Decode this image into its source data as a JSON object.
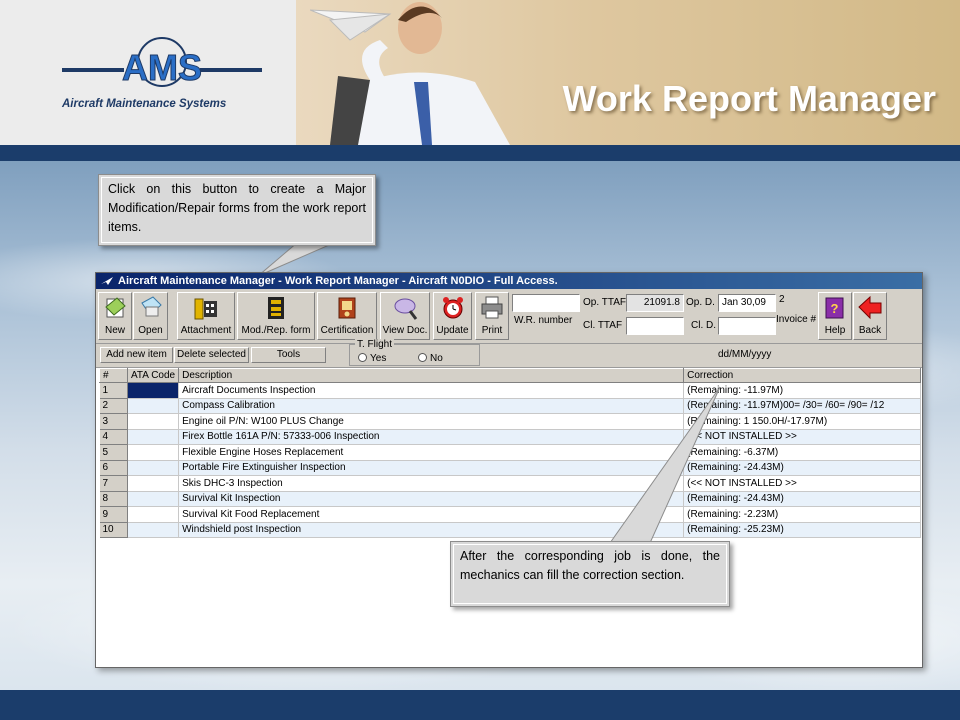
{
  "header": {
    "logo_letters": "AMS",
    "logo_tagline": "Aircraft Maintenance Systems",
    "slide_title": "Work Report Manager"
  },
  "callouts": {
    "top": "Click on this button to create a Major Modification/Repair forms from the work report items.",
    "bottom": "After the corresponding job is done, the mechanics can fill the correction section."
  },
  "window": {
    "title": "Aircraft Maintenance Manager - Work Report Manager - Aircraft N0DIO - Full Access."
  },
  "toolbar": {
    "buttons": [
      {
        "label": "New",
        "icon": "new-document-icon"
      },
      {
        "label": "Open",
        "icon": "open-document-icon"
      },
      {
        "label": "Attachment",
        "icon": "film-attachment-icon"
      },
      {
        "label": "Mod./Rep. form",
        "icon": "binder-form-icon"
      },
      {
        "label": "Certification",
        "icon": "certificate-icon"
      },
      {
        "label": "View Doc.",
        "icon": "magnifier-icon"
      },
      {
        "label": "Update",
        "icon": "alarm-clock-icon"
      },
      {
        "label": "Print",
        "icon": "printer-icon"
      },
      {
        "label": "Help",
        "icon": "help-book-icon"
      },
      {
        "label": "Back",
        "icon": "back-arrow-icon"
      }
    ],
    "wr_number_label": "W.R. number",
    "wr_number_value": "",
    "op_ttaf_label": "Op. TTAF",
    "op_ttaf_value": "21091.8",
    "cl_ttaf_label": "Cl. TTAF",
    "cl_ttaf_value": "",
    "op_d_label": "Op. D.",
    "op_d_value": "Jan 30,09",
    "cl_d_label": "Cl. D.",
    "cl_d_value": "",
    "invoice_value": "2",
    "invoice_label": "Invoice #"
  },
  "actions": {
    "add_label": "Add new item",
    "delete_label": "Delete selected",
    "tools_label": "Tools",
    "flight_group_label": "T. Flight",
    "yes_label": "Yes",
    "no_label": "No",
    "date_format": "dd/MM/yyyy"
  },
  "grid": {
    "columns": [
      "#",
      "ATA Code",
      "Description",
      "Correction"
    ],
    "rows": [
      {
        "num": "1",
        "ata": "",
        "desc": "Aircraft Documents  Inspection",
        "corr": "(Remaining: -11.97M)"
      },
      {
        "num": "2",
        "ata": "",
        "desc": "Compass  Calibration",
        "corr": "(Remaining: -11.97M)00=   /30=   /60=    /90=    /12"
      },
      {
        "num": "3",
        "ata": "",
        "desc": "Engine oil  P/N: W100 PLUS Change",
        "corr": "(Remaining: 1 150.0H/-17.97M)"
      },
      {
        "num": "4",
        "ata": "",
        "desc": "Firex Bottle 161A P/N: 57333-006 Inspection",
        "corr": "(<< NOT INSTALLED >>"
      },
      {
        "num": "5",
        "ata": "",
        "desc": "Flexible Engine Hoses  Replacement",
        "corr": "(Remaining: -6.37M)"
      },
      {
        "num": "6",
        "ata": "",
        "desc": "Portable Fire Extinguisher  Inspection",
        "corr": "(Remaining: -24.43M)"
      },
      {
        "num": "7",
        "ata": "",
        "desc": "Skis DHC-3 Inspection",
        "corr": "(<< NOT INSTALLED >>"
      },
      {
        "num": "8",
        "ata": "",
        "desc": "Survival Kit  Inspection",
        "corr": "(Remaining: -24.43M)"
      },
      {
        "num": "9",
        "ata": "",
        "desc": "Survival Kit Food  Replacement",
        "corr": "(Remaining: -2.23M)"
      },
      {
        "num": "10",
        "ata": "",
        "desc": "Windshield post  Inspection",
        "corr": "(Remaining: -25.23M)"
      }
    ]
  }
}
